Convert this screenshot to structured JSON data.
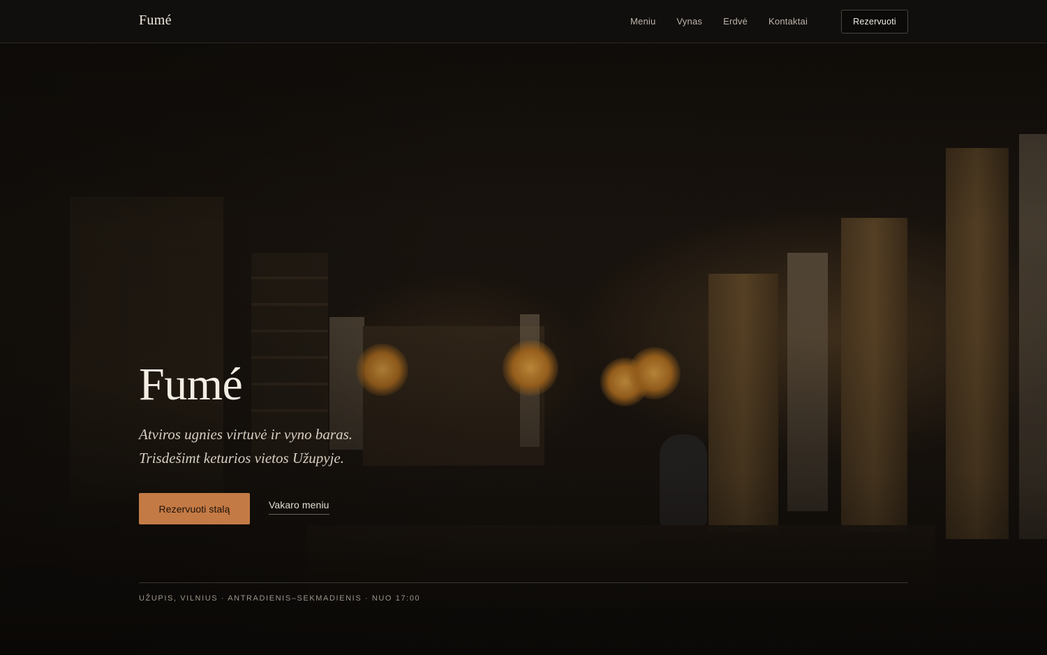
{
  "header": {
    "logo": "Fumé",
    "nav": [
      "Meniu",
      "Vynas",
      "Erdvė",
      "Kontaktai"
    ],
    "cta_label": "Rezervuoti"
  },
  "hero": {
    "title": "Fumé",
    "tagline_line1": "Atviros ugnies virtuvė ir vyno baras.",
    "tagline_line2": "Trisdešimt keturios vietos Užupyje.",
    "primary_button": "Rezervuoti stalą",
    "secondary_link": "Vakaro meniu"
  },
  "info": {
    "text": "UŽUPIS, VILNIUS · ANTRADIENIS–SEKMADIENIS · NUO 17:00"
  },
  "colors": {
    "accent": "#c47a45",
    "header_bg": "#110f0d"
  }
}
